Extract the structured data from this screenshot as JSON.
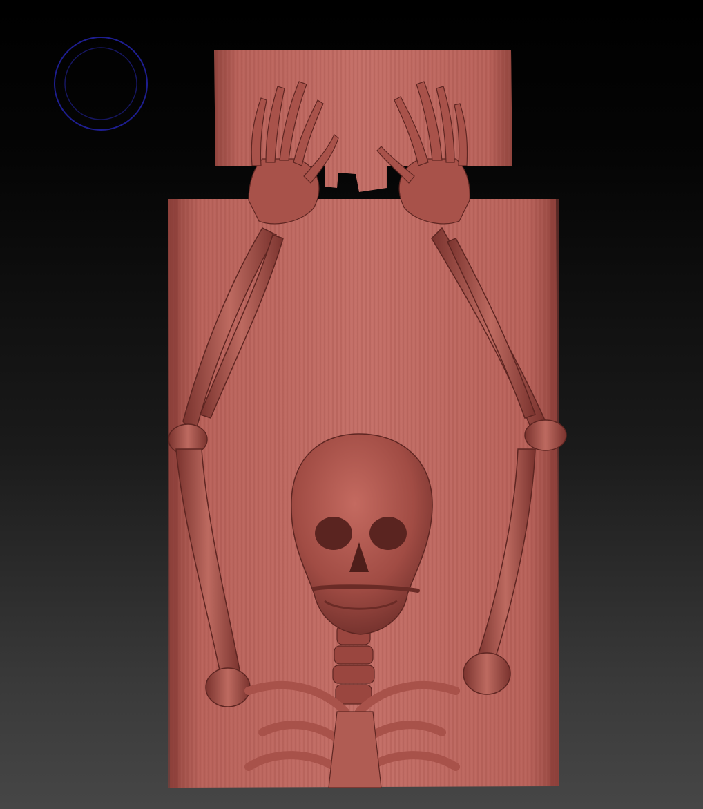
{
  "viewport": {
    "background_top": "#000000",
    "background_bottom": "#464646"
  },
  "brush_cursor": {
    "icon": "brush-radius-circle-icon",
    "outer_color": "#1a1a8a",
    "inner_color": "#14145a"
  },
  "model": {
    "description_icon": "sculpt-mesh-icon",
    "material_color": "#a8524a",
    "material_shadow": "#6e2e2a",
    "material_highlight": "#c97a70",
    "parts": [
      {
        "name": "top-plank"
      },
      {
        "name": "main-plank"
      },
      {
        "name": "skull"
      },
      {
        "name": "left-arm"
      },
      {
        "name": "right-arm"
      },
      {
        "name": "left-hand"
      },
      {
        "name": "right-hand"
      },
      {
        "name": "spine-neck"
      },
      {
        "name": "rib-cage"
      }
    ]
  }
}
